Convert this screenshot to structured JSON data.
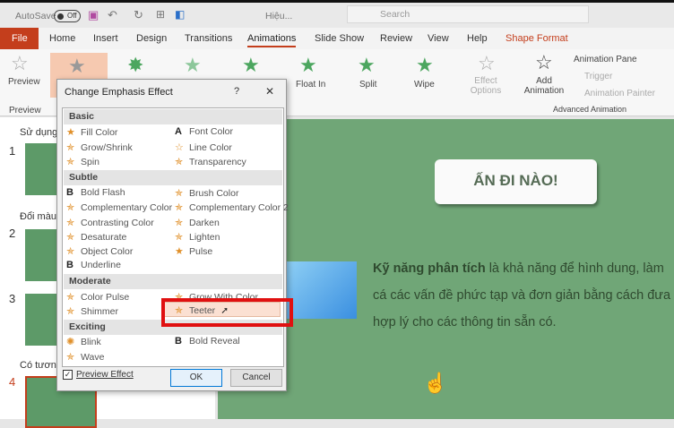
{
  "titlebar": {
    "autosave": "AutoSave",
    "toggle": "Off",
    "filename": "Hiệu...",
    "search_placeholder": "Search"
  },
  "tabs": [
    "File",
    "Home",
    "Insert",
    "Design",
    "Transitions",
    "Animations",
    "Slide Show",
    "Review",
    "View",
    "Help",
    "Shape Format"
  ],
  "ribbon": {
    "preview": "Preview",
    "preview_group": "Preview",
    "effects": [
      "Float In",
      "Split",
      "Wipe"
    ],
    "effect_options": "Effect Options",
    "add_animation": "Add Animation",
    "animation_pane": "Animation Pane",
    "trigger": "Trigger",
    "animation_painter": "Animation Painter",
    "advanced_group": "Advanced Animation"
  },
  "slides": [
    {
      "num": "1",
      "section": "Sử dụng k"
    },
    {
      "num": "2",
      "section": "Đổi màu"
    },
    {
      "num": "3"
    },
    {
      "num": "4",
      "section": "Có tương"
    }
  ],
  "slide": {
    "button": "ẤN ĐI NÀO!",
    "bold": "Kỹ năng phân tích",
    "line1": " là khả năng để hình dung, làm",
    "line2": "cá các vấn đề phức tạp và đơn giản bằng cách đưa",
    "line3": "hợp lý cho các thông tin sẵn có."
  },
  "dialog": {
    "title": "Change Emphasis Effect",
    "help": "?",
    "close": "✕",
    "sections": {
      "basic": "Basic",
      "subtle": "Subtle",
      "moderate": "Moderate",
      "exciting": "Exciting"
    },
    "basic": [
      "Fill Color",
      "Font Color",
      "Grow/Shrink",
      "Line Color",
      "Spin",
      "Transparency"
    ],
    "subtle": [
      "Bold Flash",
      "Brush Color",
      "Complementary Color",
      "Complementary Color 2",
      "Contrasting Color",
      "Darken",
      "Desaturate",
      "Lighten",
      "Object Color",
      "Pulse",
      "Underline"
    ],
    "moderate": [
      "Color Pulse",
      "Grow With Color",
      "Shimmer",
      "Teeter"
    ],
    "exciting": [
      "Blink",
      "Bold Reveal",
      "Wave"
    ],
    "preview_effect": "Preview Effect",
    "ok": "OK",
    "cancel": "Cancel",
    "selected": "Teeter"
  }
}
